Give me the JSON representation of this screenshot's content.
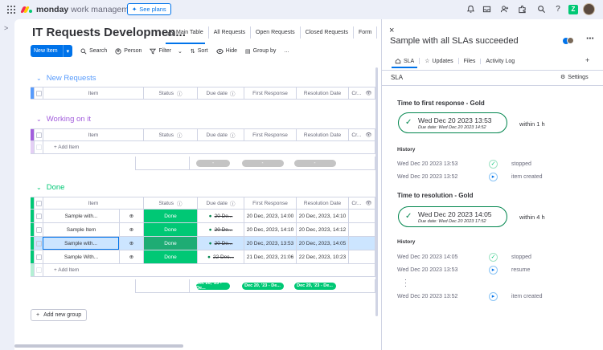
{
  "app": {
    "brand_bold": "monday",
    "brand_rest": "work management",
    "see_plans": "See plans"
  },
  "colors": {
    "accent": "#0073ea",
    "done": "#00c875",
    "new_group": "#579bfc",
    "working_group": "#a25ddc",
    "done_group": "#00c875"
  },
  "board": {
    "title": "IT Requests Developmen...",
    "views": [
      "Main Table",
      "All Requests",
      "Open Requests",
      "Closed Requests",
      "Form"
    ],
    "toolbar": {
      "new_item": "New Item",
      "search": "Search",
      "person": "Person",
      "filter": "Filter",
      "sort": "Sort",
      "hide": "Hide",
      "group_by": "Group by",
      "more": "..."
    },
    "columns": {
      "item": "Item",
      "status": "Status",
      "due": "Due date",
      "first": "First Response",
      "resolution": "Resolution Date",
      "cr": "Cr..."
    },
    "groups": {
      "new": "New Requests",
      "working": "Working on it",
      "done": "Done"
    },
    "add_item": "+ Add Item",
    "sum_dash": "-",
    "sum_pill": "Dec 20, '23 - De...",
    "done_rows": [
      {
        "name": "Sample with...",
        "status": "Done",
        "due": "20 De...",
        "first": "20 Dec, 2023, 14:00",
        "res": "20 Dec, 2023, 14:10"
      },
      {
        "name": "Sample Item",
        "status": "Done",
        "due": "20 De...",
        "first": "20 Dec, 2023, 14:10",
        "res": "20 Dec, 2023, 14:12"
      },
      {
        "name": "Sample with...",
        "status": "Done",
        "due": "20 De...",
        "first": "20 Dec, 2023, 13:53",
        "res": "20 Dec, 2023, 14:05"
      },
      {
        "name": "Sample With...",
        "status": "Done",
        "due": "22 Dec...",
        "first": "21 Dec, 2023, 21:06",
        "res": "22 Dec, 2023, 10:23"
      }
    ],
    "add_group": "Add new group"
  },
  "panel": {
    "title": "Sample with all SLAs succeeded",
    "tabs": [
      "SLA",
      "Updates",
      "Files",
      "Activity Log"
    ],
    "sub": "SLA",
    "settings": "Settings",
    "first": {
      "heading": "Time to first response - Gold",
      "date": "Wed Dec 20 2023 13:53",
      "due": "Due date: Wed Dec 20 2023 14:52",
      "within": "within 1 h"
    },
    "history_label": "History",
    "hist1": [
      {
        "time": "Wed Dec 20 2023 13:53",
        "label": "stopped"
      },
      {
        "time": "Wed Dec 20 2023 13:52",
        "label": "item created"
      }
    ],
    "res": {
      "heading": "Time to resolution - Gold",
      "date": "Wed Dec 20 2023 14:05",
      "due": "Due date: Wed Dec 20 2023 17:52",
      "within": "within 4 h"
    },
    "hist2": [
      {
        "time": "Wed Dec 20 2023 14:05",
        "label": "stopped"
      },
      {
        "time": "Wed Dec 20 2023 13:53",
        "label": "resume"
      },
      {
        "time": "Wed Dec 20 2023 13:52",
        "label": "item created"
      }
    ]
  }
}
